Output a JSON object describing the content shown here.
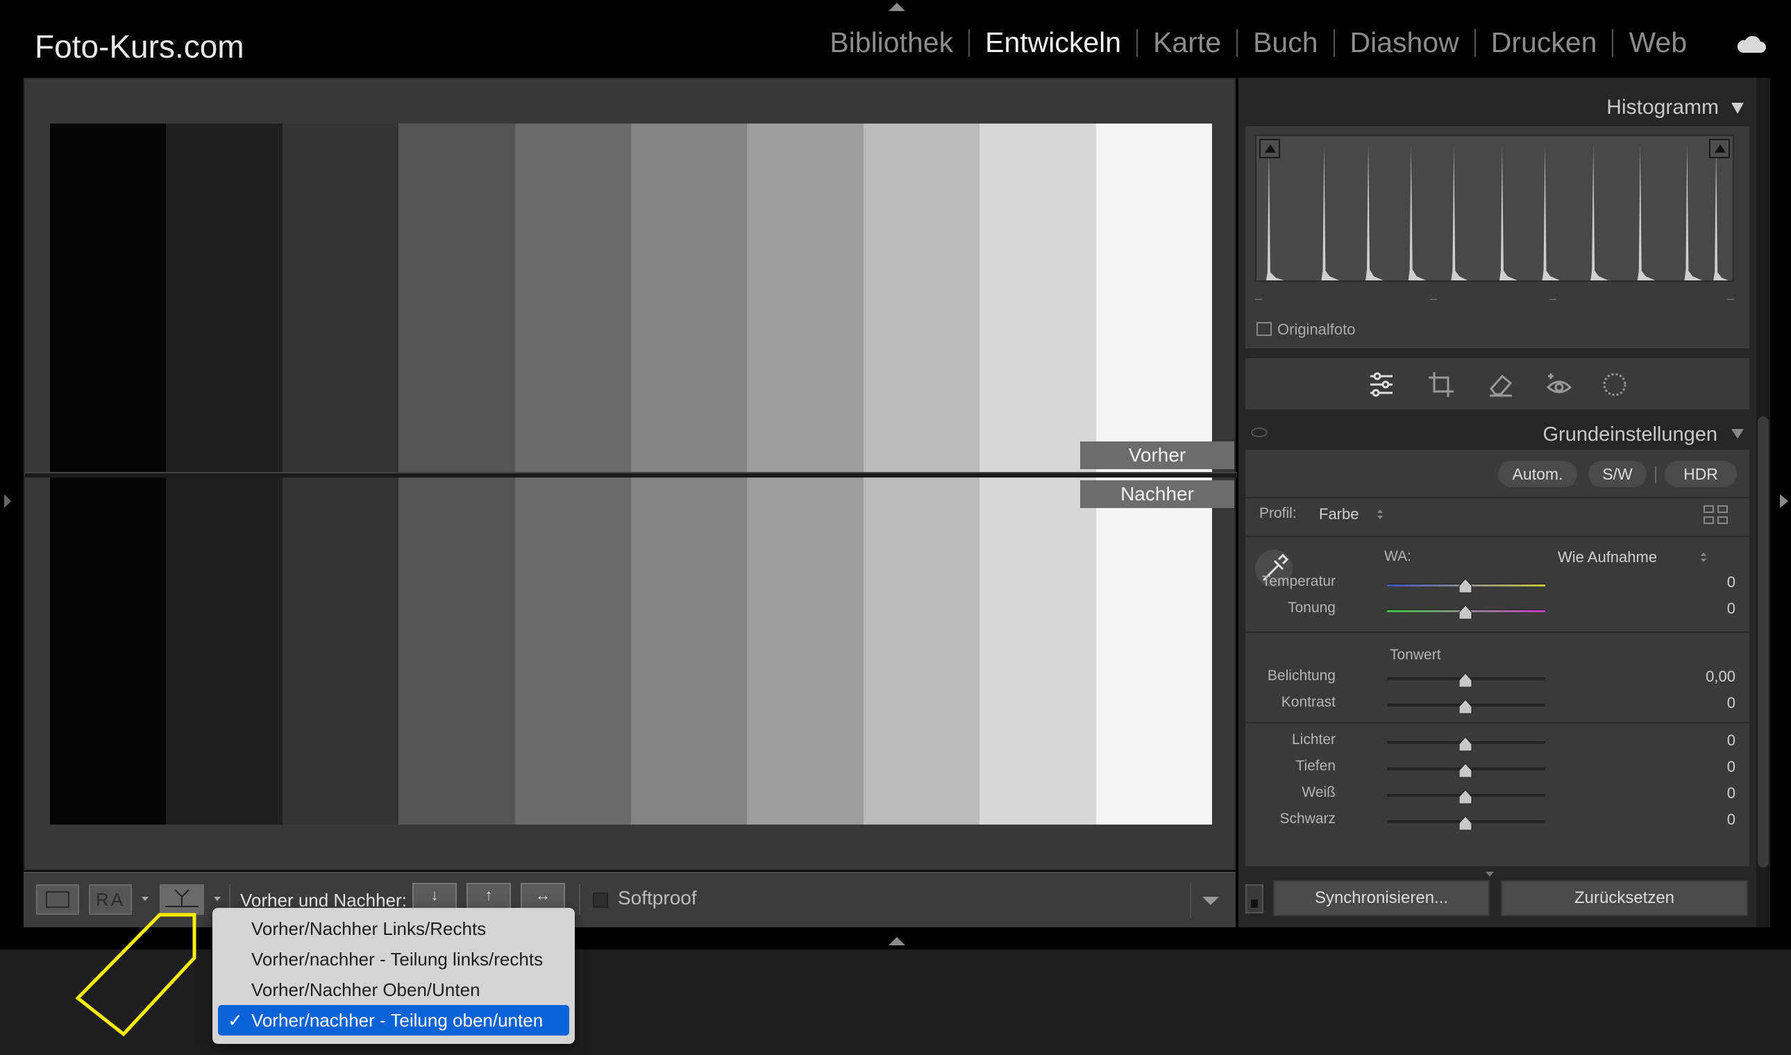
{
  "app": {
    "brand": "Foto-Kurs.com"
  },
  "modules": [
    {
      "label": "Bibliothek",
      "active": false
    },
    {
      "label": "Entwickeln",
      "active": true
    },
    {
      "label": "Karte",
      "active": false
    },
    {
      "label": "Buch",
      "active": false
    },
    {
      "label": "Diashow",
      "active": false
    },
    {
      "label": "Drucken",
      "active": false
    },
    {
      "label": "Web",
      "active": false
    }
  ],
  "preview": {
    "before_label": "Vorher",
    "after_label": "Nachher",
    "stripes": [
      "#050505",
      "#1f1f1f",
      "#333333",
      "#555555",
      "#6a6a6a",
      "#848484",
      "#9d9d9d",
      "#bababa",
      "#d7d7d7",
      "#f4f4f4"
    ]
  },
  "toolbar": {
    "ra_label": "RA",
    "before_after_label": "Vorher und Nachher:",
    "copy_down": "↓",
    "copy_up": "↑",
    "swap": "↔",
    "softproof_label": "Softproof"
  },
  "menu": {
    "items": [
      {
        "label": "Vorher/Nachher Links/Rechts",
        "selected": false
      },
      {
        "label": "Vorher/nachher - Teilung links/rechts",
        "selected": false
      },
      {
        "label": "Vorher/Nachher Oben/Unten",
        "selected": false
      },
      {
        "label": "Vorher/nachher - Teilung oben/unten",
        "selected": true
      }
    ],
    "check_mark": "✓",
    "highlight_color": "#ffee00"
  },
  "histogram": {
    "title": "Histogramm",
    "original_photo_label": "Originalfoto",
    "dashes": [
      "–",
      "–",
      "–",
      "–"
    ]
  },
  "basic": {
    "title": "Grundeinstellungen",
    "auto_label": "Autom.",
    "bw_label": "S/W",
    "hdr_label": "HDR",
    "profile_label": "Profil:",
    "profile_value": "Farbe",
    "wb_label": "WA:",
    "wb_value": "Wie Aufnahme",
    "tone_heading": "Tonwert",
    "sliders": [
      {
        "label": "Temperatur",
        "value": "0"
      },
      {
        "label": "Tonung",
        "value": "0"
      },
      {
        "label": "Belichtung",
        "value": "0,00"
      },
      {
        "label": "Kontrast",
        "value": "0"
      },
      {
        "label": "Lichter",
        "value": "0"
      },
      {
        "label": "Tiefen",
        "value": "0"
      },
      {
        "label": "Weiß",
        "value": "0"
      },
      {
        "label": "Schwarz",
        "value": "0"
      }
    ]
  },
  "footer": {
    "sync_label": "Synchronisieren...",
    "reset_label": "Zurücksetzen"
  }
}
